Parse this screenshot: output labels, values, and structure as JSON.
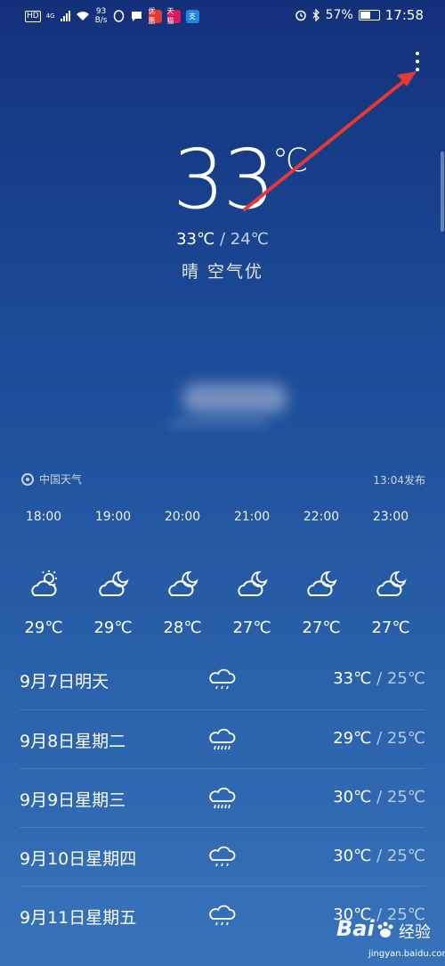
{
  "status_bar": {
    "hd": "HD",
    "network": "4G",
    "speed_value": "93",
    "speed_unit": "B/s",
    "app_badge_1": "优惠",
    "app_badge_2": "天猫",
    "app_badge_3": "支",
    "battery": "57%",
    "battery_level": 0.57,
    "time": "17:58"
  },
  "current": {
    "temperature": "33",
    "unit": "℃",
    "high": "33℃",
    "separator": " / ",
    "low": "24℃",
    "condition": "晴  空气优"
  },
  "source": {
    "name": "中国天气",
    "published": "13:04发布"
  },
  "hourly": [
    {
      "time": "18:00",
      "icon": "sunny-cloudy-icon",
      "temp": "29℃"
    },
    {
      "time": "19:00",
      "icon": "night-cloudy-icon",
      "temp": "29℃"
    },
    {
      "time": "20:00",
      "icon": "night-cloudy-icon",
      "temp": "28℃"
    },
    {
      "time": "21:00",
      "icon": "night-cloudy-icon",
      "temp": "27℃"
    },
    {
      "time": "22:00",
      "icon": "night-cloudy-icon",
      "temp": "27℃"
    },
    {
      "time": "23:00",
      "icon": "night-cloudy-icon",
      "temp": "27℃"
    }
  ],
  "daily": [
    {
      "date": "9月7日明天",
      "icon": "light-rain-icon",
      "high": "33℃",
      "low": "25℃"
    },
    {
      "date": "9月8日星期二",
      "icon": "heavy-rain-icon",
      "high": "29℃",
      "low": "25℃"
    },
    {
      "date": "9月9日星期三",
      "icon": "heavy-rain-icon",
      "high": "30℃",
      "low": "25℃"
    },
    {
      "date": "9月10日星期四",
      "icon": "light-rain-icon",
      "high": "30℃",
      "low": "25℃"
    },
    {
      "date": "9月11日星期五",
      "icon": "light-rain-icon",
      "high": "30℃",
      "low": "25℃"
    }
  ],
  "daily_separator": " / ",
  "watermark": {
    "brand": "Bai",
    "brand_cn": "经验",
    "site": "jingyan.baidu.com"
  },
  "colors": {
    "annotation_arrow": "#e53935",
    "background_top": "#13317a",
    "background_bottom": "#3773bb"
  }
}
